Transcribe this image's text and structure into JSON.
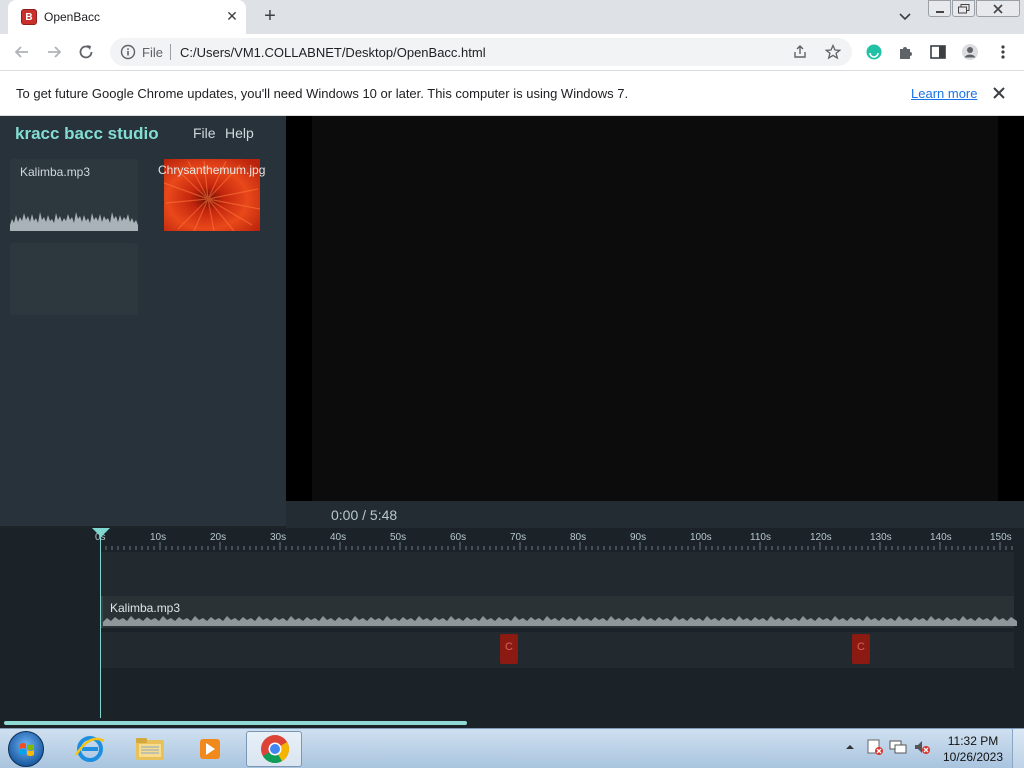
{
  "browser": {
    "tab_title": "OpenBacc",
    "tab_favicon": "B",
    "scheme": "File",
    "url": "C:/Users/VM1.COLLABNET/Desktop/OpenBacc.html"
  },
  "infobar": {
    "message": "To get future Google Chrome updates, you'll need Windows 10 or later. This computer is using Windows 7.",
    "link": "Learn more"
  },
  "app": {
    "brand": "kracc bacc studio",
    "menu": {
      "file": "File",
      "help": "Help"
    },
    "assets": [
      {
        "name": "Kalimba.mp3",
        "kind": "audio"
      },
      {
        "name": "Chrysanthemum.jpg",
        "kind": "image"
      }
    ],
    "time_display": "0:00 / 5:48",
    "ruler_ticks": [
      "0s",
      "10s",
      "20s",
      "30s",
      "40s",
      "50s",
      "60s",
      "70s",
      "80s",
      "90s",
      "100s",
      "110s",
      "120s",
      "130s",
      "140s",
      "150s"
    ],
    "audio_clip_label": "Kalimba.mp3",
    "image_clip_letter": "C",
    "accent_color": "#83ddd4"
  },
  "taskbar": {
    "time": "11:32 PM",
    "date": "10/26/2023"
  }
}
